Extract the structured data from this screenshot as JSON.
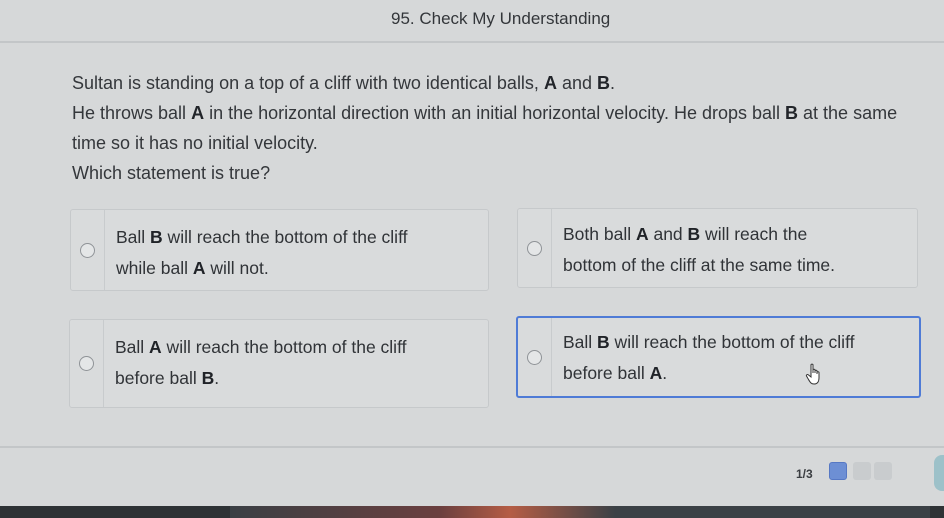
{
  "header": {
    "title": "95. Check My Understanding"
  },
  "question": {
    "line1_pre": "Sultan is standing on a top of a cliff with two identical balls, ",
    "line1_a": "A",
    "line1_mid": " and ",
    "line1_b": "B",
    "line1_end": ".",
    "line2_pre": "He throws ball ",
    "line2_a": "A",
    "line2_mid": " in the horizontal direction with an initial horizontal velocity. He drops ball ",
    "line2_b": "B",
    "line2_end": " at the same time so it has no initial velocity.",
    "line3": "Which statement is true?"
  },
  "options": [
    {
      "p1": "Ball ",
      "b1": "B",
      "p2": " will reach the bottom of the cliff",
      "p3": "while ball ",
      "b2": "A",
      "p4": " will not."
    },
    {
      "p1": "Both ball ",
      "b1": "A",
      "p2": " and ",
      "b2": "B",
      "p3": " will reach the",
      "p4": "bottom of the cliff at the same time."
    },
    {
      "p1": "Ball ",
      "b1": "A",
      "p2": " will reach the bottom of the cliff",
      "p3": "before ball ",
      "b2": "B",
      "p4": "."
    },
    {
      "p1": "Ball ",
      "b1": "B",
      "p2": " will reach the bottom of the cliff",
      "p3": "before ball ",
      "b2": "A",
      "p4": "."
    }
  ],
  "selected_option": 4,
  "pager": {
    "label": "1/3"
  },
  "icons": {
    "cursor": "hand-pointer-icon",
    "radio": "radio-circle-icon"
  },
  "colors": {
    "selected_border": "#4f7bd6",
    "active_page": "#6d8fd4"
  }
}
